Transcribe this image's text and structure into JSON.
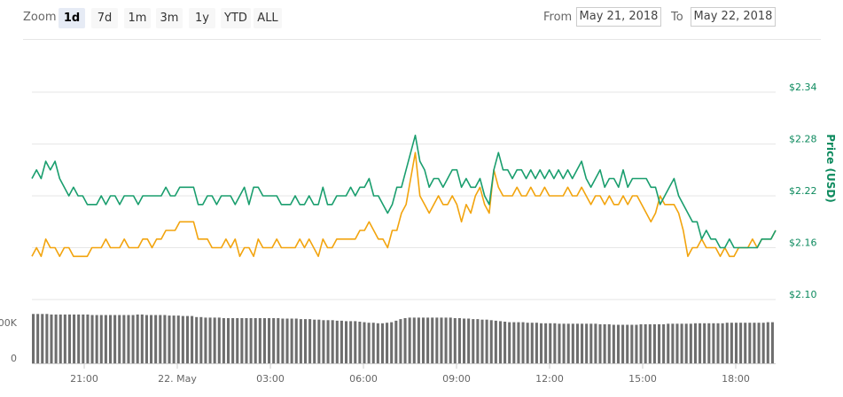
{
  "toolbar": {
    "zoom_label": "Zoom",
    "ranges": [
      "1d",
      "7d",
      "1m",
      "3m",
      "1y",
      "YTD",
      "ALL"
    ],
    "active_range": "1d",
    "from_label": "From",
    "from_value": "May 21, 2018",
    "to_label": "To",
    "to_value": "May 22, 2018"
  },
  "colors": {
    "price_line": "#1a9e6e",
    "secondary_line": "#f2a40e",
    "volume_bars": "#6e6e6e",
    "grid": "#e6e6e6",
    "axis_text": "#666666",
    "price_axis_text": "#0d8a5e"
  },
  "chart_data": {
    "type": "line",
    "x_tick_labels": [
      "21:00",
      "22. May",
      "03:00",
      "06:00",
      "09:00",
      "12:00",
      "15:00",
      "18:00"
    ],
    "ylabel": "Price (USD)",
    "y_tick_labels": [
      "$2.10",
      "$2.16",
      "$2.22",
      "$2.28",
      "$2.34"
    ],
    "ylim": [
      2.1,
      2.34
    ],
    "grid": true,
    "series": [
      {
        "values": [
          2.24,
          2.25,
          2.24,
          2.26,
          2.25,
          2.26,
          2.24,
          2.23,
          2.22,
          2.23,
          2.22,
          2.22,
          2.21,
          2.21,
          2.21,
          2.22,
          2.21,
          2.22,
          2.22,
          2.21,
          2.22,
          2.22,
          2.22,
          2.21,
          2.22,
          2.22,
          2.22,
          2.22,
          2.22,
          2.23,
          2.22,
          2.22,
          2.23,
          2.23,
          2.23,
          2.23,
          2.21,
          2.21,
          2.22,
          2.22,
          2.21,
          2.22,
          2.22,
          2.22,
          2.21,
          2.22,
          2.23,
          2.21,
          2.23,
          2.23,
          2.22,
          2.22,
          2.22,
          2.22,
          2.21,
          2.21,
          2.21,
          2.22,
          2.21,
          2.21,
          2.22,
          2.21,
          2.21,
          2.23,
          2.21,
          2.21,
          2.22,
          2.22,
          2.22,
          2.23,
          2.22,
          2.23,
          2.23,
          2.24,
          2.22,
          2.22,
          2.21,
          2.2,
          2.21,
          2.23,
          2.23,
          2.25,
          2.27,
          2.29,
          2.26,
          2.25,
          2.23,
          2.24,
          2.24,
          2.23,
          2.24,
          2.25,
          2.25,
          2.23,
          2.24,
          2.23,
          2.23,
          2.24,
          2.22,
          2.21,
          2.25,
          2.27,
          2.25,
          2.25,
          2.24,
          2.25,
          2.25,
          2.24,
          2.25,
          2.24,
          2.25,
          2.24,
          2.25,
          2.24,
          2.25,
          2.24,
          2.25,
          2.24,
          2.25,
          2.26,
          2.24,
          2.23,
          2.24,
          2.25,
          2.23,
          2.24,
          2.24,
          2.23,
          2.25,
          2.23,
          2.24,
          2.24,
          2.24,
          2.24,
          2.23,
          2.23,
          2.21,
          2.22,
          2.23,
          2.24,
          2.22,
          2.21,
          2.2,
          2.19,
          2.19,
          2.17,
          2.18,
          2.17,
          2.17,
          2.16,
          2.16,
          2.17,
          2.16,
          2.16,
          2.16,
          2.16,
          2.16,
          2.16,
          2.17,
          2.17,
          2.17,
          2.18
        ]
      },
      {
        "values": [
          2.15,
          2.16,
          2.15,
          2.17,
          2.16,
          2.16,
          2.15,
          2.16,
          2.16,
          2.15,
          2.15,
          2.15,
          2.15,
          2.16,
          2.16,
          2.16,
          2.17,
          2.16,
          2.16,
          2.16,
          2.17,
          2.16,
          2.16,
          2.16,
          2.17,
          2.17,
          2.16,
          2.17,
          2.17,
          2.18,
          2.18,
          2.18,
          2.19,
          2.19,
          2.19,
          2.19,
          2.17,
          2.17,
          2.17,
          2.16,
          2.16,
          2.16,
          2.17,
          2.16,
          2.17,
          2.15,
          2.16,
          2.16,
          2.15,
          2.17,
          2.16,
          2.16,
          2.16,
          2.17,
          2.16,
          2.16,
          2.16,
          2.16,
          2.17,
          2.16,
          2.17,
          2.16,
          2.15,
          2.17,
          2.16,
          2.16,
          2.17,
          2.17,
          2.17,
          2.17,
          2.17,
          2.18,
          2.18,
          2.19,
          2.18,
          2.17,
          2.17,
          2.16,
          2.18,
          2.18,
          2.2,
          2.21,
          2.24,
          2.27,
          2.22,
          2.21,
          2.2,
          2.21,
          2.22,
          2.21,
          2.21,
          2.22,
          2.21,
          2.19,
          2.21,
          2.2,
          2.22,
          2.23,
          2.21,
          2.2,
          2.25,
          2.23,
          2.22,
          2.22,
          2.22,
          2.23,
          2.22,
          2.22,
          2.23,
          2.22,
          2.22,
          2.23,
          2.22,
          2.22,
          2.22,
          2.22,
          2.23,
          2.22,
          2.22,
          2.23,
          2.22,
          2.21,
          2.22,
          2.22,
          2.21,
          2.22,
          2.21,
          2.21,
          2.22,
          2.21,
          2.22,
          2.22,
          2.21,
          2.2,
          2.19,
          2.2,
          2.22,
          2.21,
          2.21,
          2.21,
          2.2,
          2.18,
          2.15,
          2.16,
          2.16,
          2.17,
          2.16,
          2.16,
          2.16,
          2.15,
          2.16,
          2.15,
          2.15,
          2.16,
          2.16,
          2.16,
          2.17,
          2.16,
          2.17,
          2.17,
          2.17,
          2.18
        ]
      }
    ],
    "volume": {
      "y_tick_labels": [
        "00K",
        "0"
      ],
      "values": [
        0.96,
        0.96,
        0.96,
        0.96,
        0.95,
        0.95,
        0.95,
        0.95,
        0.95,
        0.95,
        0.95,
        0.95,
        0.95,
        0.94,
        0.94,
        0.94,
        0.94,
        0.94,
        0.94,
        0.94,
        0.94,
        0.94,
        0.94,
        0.95,
        0.95,
        0.94,
        0.94,
        0.94,
        0.94,
        0.94,
        0.93,
        0.93,
        0.93,
        0.92,
        0.92,
        0.92,
        0.9,
        0.9,
        0.89,
        0.89,
        0.89,
        0.89,
        0.88,
        0.88,
        0.88,
        0.88,
        0.88,
        0.88,
        0.88,
        0.88,
        0.88,
        0.88,
        0.88,
        0.88,
        0.88,
        0.87,
        0.87,
        0.87,
        0.87,
        0.86,
        0.86,
        0.86,
        0.85,
        0.85,
        0.84,
        0.84,
        0.84,
        0.83,
        0.83,
        0.82,
        0.82,
        0.82,
        0.81,
        0.8,
        0.79,
        0.79,
        0.78,
        0.78,
        0.79,
        0.8,
        0.83,
        0.86,
        0.88,
        0.89,
        0.89,
        0.89,
        0.89,
        0.89,
        0.89,
        0.89,
        0.89,
        0.89,
        0.89,
        0.88,
        0.88,
        0.87,
        0.87,
        0.86,
        0.86,
        0.85,
        0.85,
        0.84,
        0.83,
        0.82,
        0.81,
        0.8,
        0.8,
        0.8,
        0.8,
        0.79,
        0.79,
        0.79,
        0.78,
        0.78,
        0.78,
        0.78,
        0.77,
        0.77,
        0.77,
        0.77,
        0.77,
        0.77,
        0.77,
        0.77,
        0.77,
        0.76,
        0.76,
        0.76,
        0.75,
        0.75,
        0.75,
        0.75,
        0.75,
        0.75,
        0.76,
        0.76,
        0.76,
        0.76,
        0.76,
        0.76,
        0.77,
        0.77,
        0.77,
        0.77,
        0.77,
        0.77,
        0.78,
        0.78,
        0.78,
        0.78,
        0.78,
        0.78,
        0.78,
        0.79,
        0.79,
        0.79,
        0.79,
        0.79,
        0.79,
        0.79,
        0.79,
        0.79,
        0.8,
        0.8
      ]
    }
  }
}
